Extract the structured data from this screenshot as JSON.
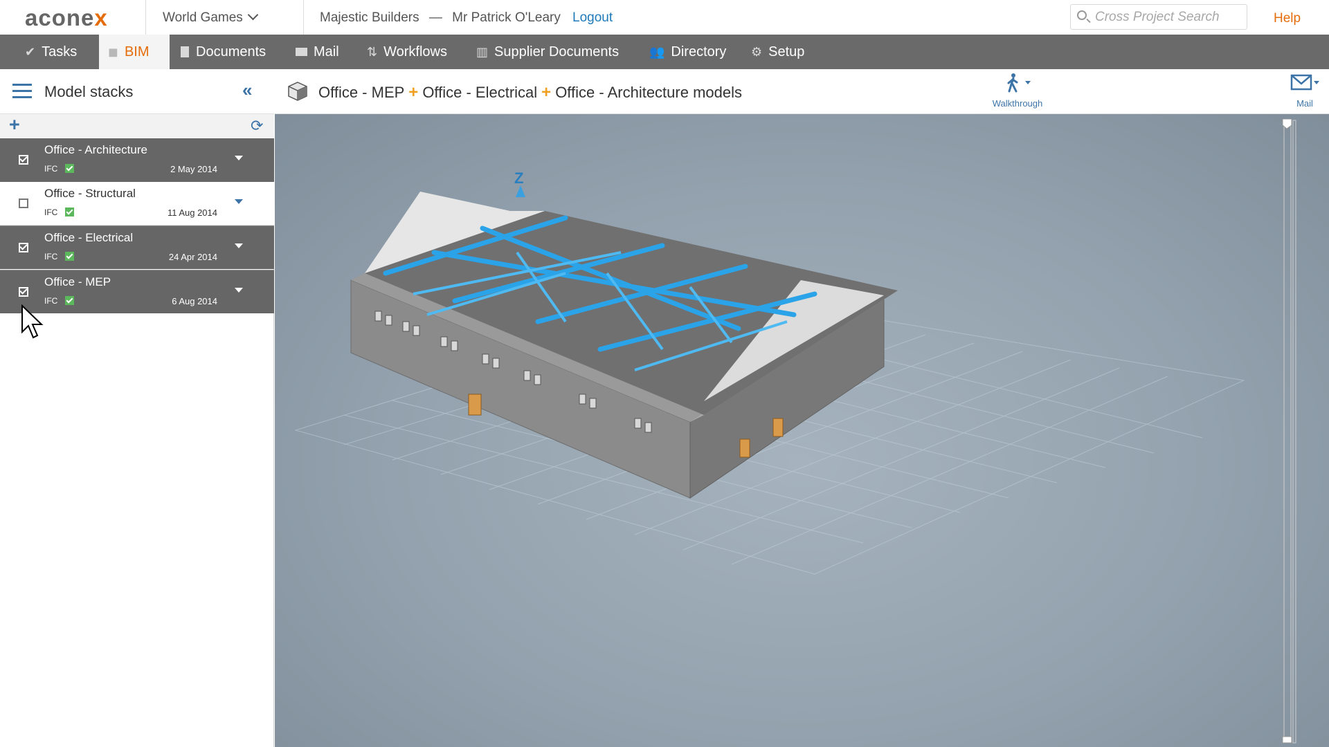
{
  "app": {
    "logo_main": "acone",
    "logo_accent": "x",
    "project": "World Games",
    "organization": "Majestic Builders",
    "separator": "—",
    "user": "Mr Patrick O'Leary",
    "logout": "Logout",
    "search_placeholder": "Cross Project Search",
    "help": "Help",
    "accent_color": "#e46c0a",
    "link_color": "#1f7ab9"
  },
  "nav": {
    "tasks": "Tasks",
    "bim": "BIM",
    "documents": "Documents",
    "mail": "Mail",
    "workflows": "Workflows",
    "supplier_documents": "Supplier Documents",
    "directory": "Directory",
    "setup": "Setup",
    "active": "BIM"
  },
  "panel": {
    "title": "Model stacks",
    "stacks": [
      {
        "name": "Office - Architecture",
        "type": "IFC",
        "date": "2 May 2014",
        "checked": true
      },
      {
        "name": "Office - Structural",
        "type": "IFC",
        "date": "11 Aug 2014",
        "checked": false
      },
      {
        "name": "Office - Electrical",
        "type": "IFC",
        "date": "24 Apr 2014",
        "checked": true
      },
      {
        "name": "Office - MEP",
        "type": "IFC",
        "date": "6 Aug 2014",
        "checked": true
      }
    ]
  },
  "viewer": {
    "crumb_1": "Office - MEP",
    "crumb_2": "Office - Electrical",
    "crumb_3": "Office - Architecture models",
    "plus": "+",
    "walkthrough_label": "Walkthrough",
    "mail_label": "Mail",
    "axis_label": "Z",
    "icons": [
      "cube-icon",
      "walkthrough-icon",
      "mail-icon"
    ]
  }
}
